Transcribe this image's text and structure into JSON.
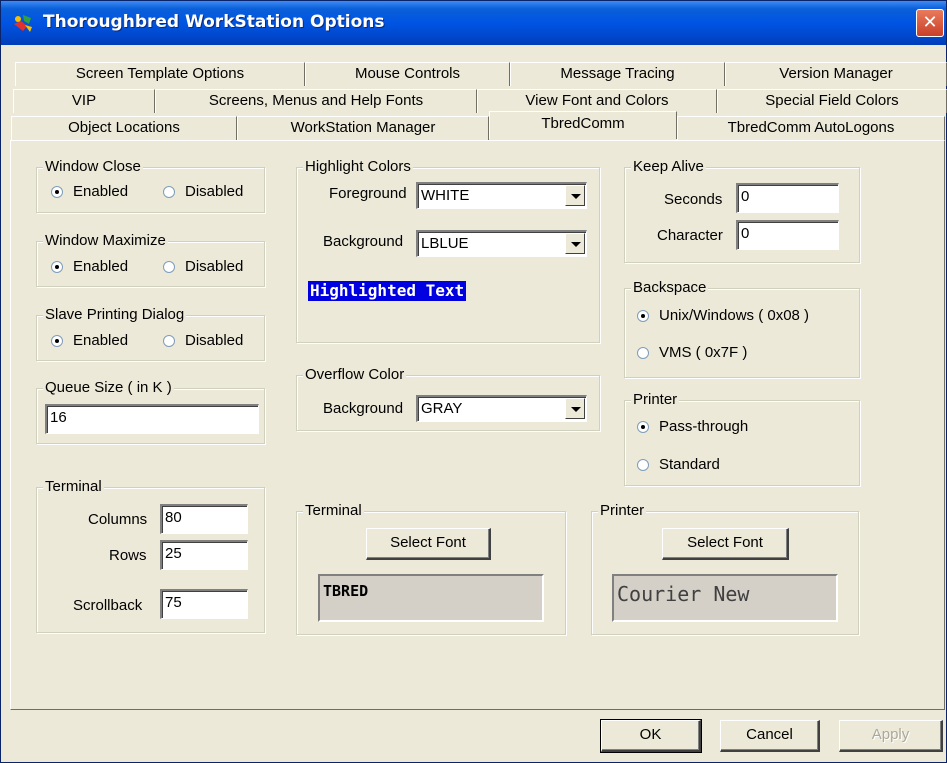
{
  "window": {
    "title": "Thoroughbred WorkStation Options"
  },
  "tabs": {
    "row1": [
      "Screen Template Options",
      "Mouse Controls",
      "Message Tracing",
      "Version Manager"
    ],
    "row2": [
      "VIP",
      "Screens, Menus and Help Fonts",
      "View Font and Colors",
      "Special Field Colors"
    ],
    "row3": [
      "Object Locations",
      "WorkStation Manager",
      "TbredComm",
      "TbredComm AutoLogons"
    ],
    "active": "TbredComm"
  },
  "window_close": {
    "label": "Window Close",
    "enabled": "Enabled",
    "disabled": "Disabled",
    "selected": "Enabled"
  },
  "window_maximize": {
    "label": "Window Maximize",
    "enabled": "Enabled",
    "disabled": "Disabled",
    "selected": "Enabled"
  },
  "slave_printing": {
    "label": "Slave Printing Dialog",
    "enabled": "Enabled",
    "disabled": "Disabled",
    "selected": "Enabled"
  },
  "queue_size": {
    "label": "Queue Size ( in K )",
    "value": "16"
  },
  "terminal_settings": {
    "label": "Terminal",
    "columns_label": "Columns",
    "columns": "80",
    "rows_label": "Rows",
    "rows": "25",
    "scrollback_label": "Scrollback",
    "scrollback": "75"
  },
  "highlight_colors": {
    "label": "Highlight Colors",
    "foreground_label": "Foreground",
    "foreground": "WHITE",
    "background_label": "Background",
    "background": "LBLUE",
    "sample": "Highlighted Text",
    "sample_bg": "#0000e0",
    "sample_fg": "#ffffff"
  },
  "overflow_color": {
    "label": "Overflow Color",
    "background_label": "Background",
    "background": "GRAY"
  },
  "keep_alive": {
    "label": "Keep Alive",
    "seconds_label": "Seconds",
    "seconds": "0",
    "character_label": "Character",
    "character": "0"
  },
  "backspace": {
    "label": "Backspace",
    "opt1": "Unix/Windows ( 0x08 )",
    "opt2": "VMS ( 0x7F )",
    "selected": "opt1"
  },
  "printer_mode": {
    "label": "Printer",
    "opt1": "Pass-through",
    "opt2": "Standard",
    "selected": "opt1"
  },
  "terminal_font": {
    "label": "Terminal",
    "button": "Select Font",
    "preview": "TBRED"
  },
  "printer_font": {
    "label": "Printer",
    "button": "Select Font",
    "preview": "Courier New"
  },
  "footer": {
    "ok": "OK",
    "cancel": "Cancel",
    "apply": "Apply"
  }
}
